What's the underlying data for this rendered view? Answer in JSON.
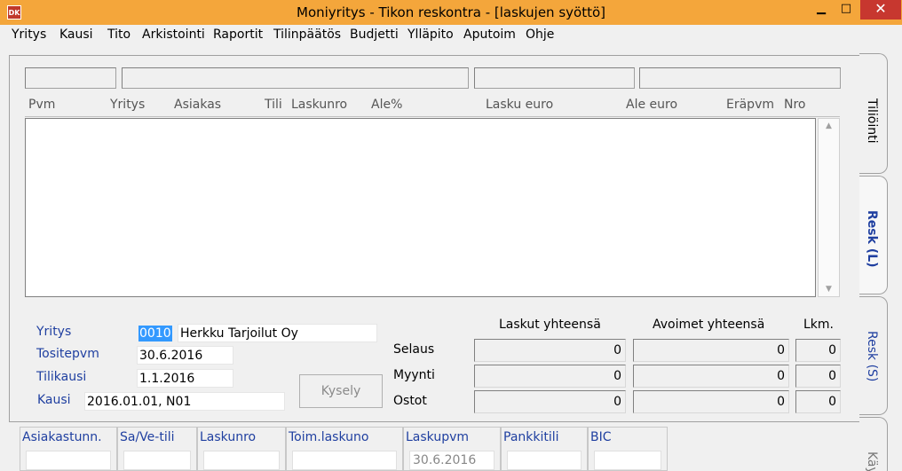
{
  "window": {
    "title": "Moniyritys - Tikon reskontra - [laskujen syöttö]",
    "icon_text": "DK",
    "minimize": "▁",
    "maximize": "□",
    "close": "✕",
    "titlebar_color": "#f4a63b",
    "close_color": "#c7372f"
  },
  "menu": [
    "Yritys",
    "Kausi",
    "Tito",
    "Arkistointi",
    "Raportit",
    "Tilinpäätös",
    "Budjetti",
    "Ylläpito",
    "Aputoim",
    "Ohje"
  ],
  "list": {
    "columns": [
      "Pvm",
      "Yritys",
      "Asiakas",
      "Tili",
      "Laskunro",
      "Ale%",
      "Lasku euro",
      "Ale euro",
      "Eräpvm",
      "Nro"
    ],
    "scroll_up": "▲",
    "scroll_down": "▼"
  },
  "form": {
    "yritys_label": "Yritys",
    "yritys_code": "0010",
    "yritys_name": "Herkku Tarjoilut Oy",
    "tositepvm_label": "Tositepvm",
    "tositepvm_value": "30.6.2016",
    "tilikausi_label": "Tilikausi",
    "tilikausi_value": "1.1.2016",
    "kausi_label": "Kausi",
    "kausi_value": "2016.01.01, N01",
    "kysely_label": "Kysely"
  },
  "totals": {
    "headers": {
      "laskut": "Laskut yhteensä",
      "avoimet": "Avoimet yhteensä",
      "lkm": "Lkm."
    },
    "rows": [
      {
        "label": "Selaus",
        "laskut": "0",
        "avoimet": "0",
        "lkm": "0"
      },
      {
        "label": "Myynti",
        "laskut": "0",
        "avoimet": "0",
        "lkm": "0"
      },
      {
        "label": "Ostot",
        "laskut": "0",
        "avoimet": "0",
        "lkm": "0"
      }
    ]
  },
  "tabs": [
    "Tiliöinti",
    "Resk (L)",
    "Resk (S)",
    "Käy"
  ],
  "bottom_fields": [
    {
      "label": "Asiakastunn.",
      "value": ""
    },
    {
      "label": "Sa/Ve-tili",
      "value": ""
    },
    {
      "label": "Laskunro",
      "value": ""
    },
    {
      "label": "Toim.laskuno",
      "value": ""
    },
    {
      "label": "Laskupvm",
      "value": "30.6.2016"
    },
    {
      "label": "Pankkitili",
      "value": ""
    },
    {
      "label": "BIC",
      "value": ""
    }
  ]
}
